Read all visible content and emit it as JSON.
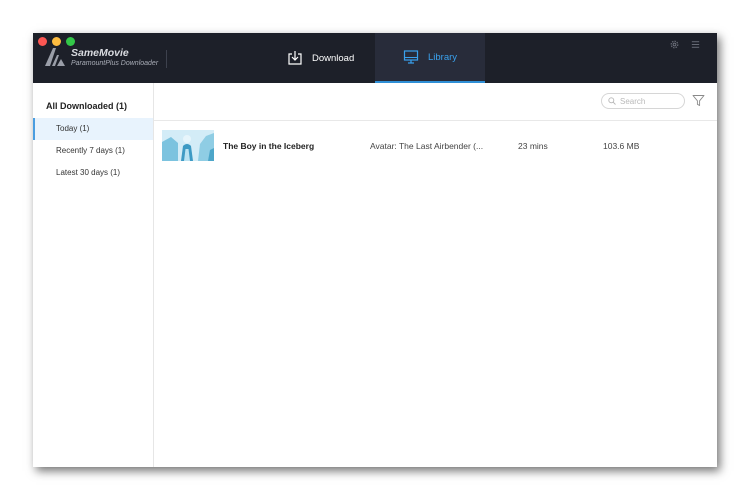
{
  "app": {
    "name": "SameMovie",
    "subtitle": "ParamountPlus Downloader"
  },
  "tabs": {
    "download": "Download",
    "library": "Library"
  },
  "sidebar": {
    "header": "All Downloaded (1)",
    "items": [
      {
        "label": "Today (1)",
        "active": true
      },
      {
        "label": "Recently 7 days (1)",
        "active": false
      },
      {
        "label": "Latest 30 days (1)",
        "active": false
      }
    ]
  },
  "search": {
    "placeholder": "Search"
  },
  "library": {
    "rows": [
      {
        "title": "The Boy in the Iceberg",
        "series": "Avatar: The Last Airbender (...",
        "duration": "23 mins",
        "size": "103.6 MB"
      }
    ]
  },
  "colors": {
    "titlebar": "#1d2029",
    "active_tab_bg": "#282c3a",
    "accent": "#3aa2ee",
    "sidebar_active_bg": "#e8f3fd"
  },
  "icons": {
    "download_tab": "download-tray-icon",
    "library_tab": "monitor-icon",
    "settings": "gear-icon",
    "menu": "hamburger-menu-icon",
    "search": "search-icon",
    "filter": "filter-funnel-icon"
  }
}
